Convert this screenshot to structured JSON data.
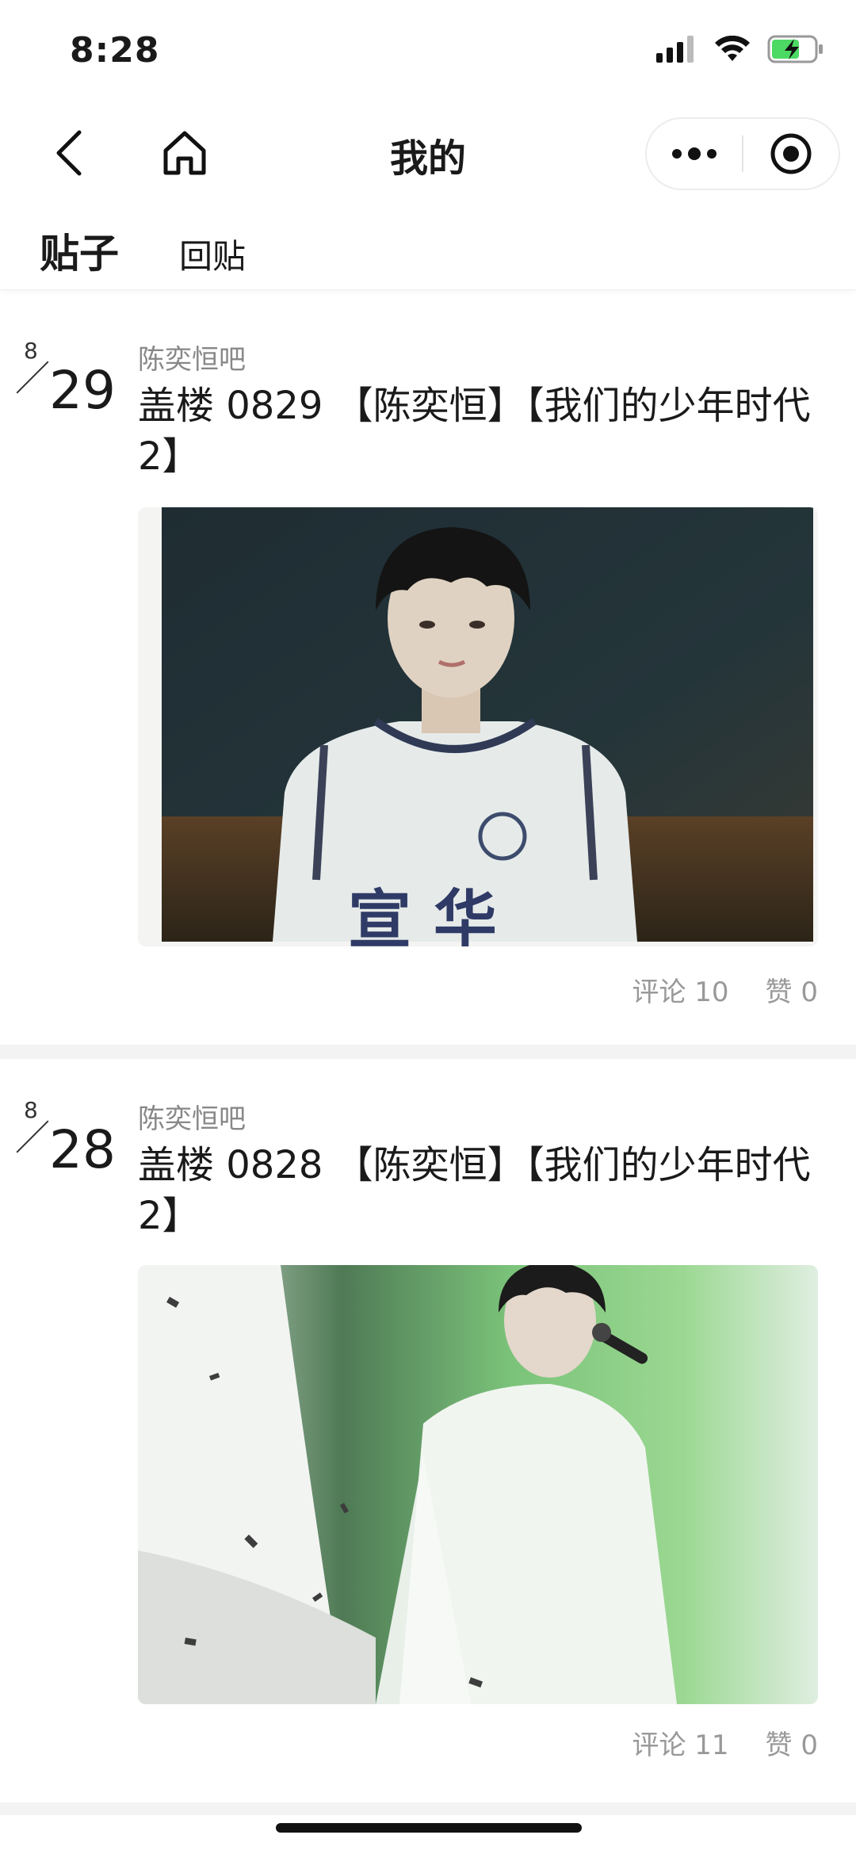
{
  "status_bar": {
    "time": "8:28",
    "icons": [
      "signal-icon",
      "wifi-icon",
      "battery-charging-icon"
    ]
  },
  "nav": {
    "title": "我的",
    "back_icon": "chevron-left-icon",
    "home_icon": "home-icon",
    "menu_icon": "more-dots-icon",
    "close_icon": "record-target-icon"
  },
  "tabs": [
    {
      "label": "贴子",
      "active": true
    },
    {
      "label": "回贴",
      "active": false
    }
  ],
  "posts": [
    {
      "month": "8",
      "day": "29",
      "forum": "陈奕恒吧",
      "title": "盖楼 0829 【陈奕恒】【我们的少年时代2】",
      "comments": "评论 10",
      "likes": "赞 0",
      "photo_desc": "portrait-photo"
    },
    {
      "month": "8",
      "day": "28",
      "forum": "陈奕恒吧",
      "title": "盖楼 0828 【陈奕恒】【我们的少年时代2】",
      "comments": "评论 11",
      "likes": "赞 0",
      "photo_desc": "stage-photo"
    }
  ],
  "colors": {
    "background": "#ffffff",
    "separator": "#f3f3f3",
    "muted_text": "#888888"
  }
}
